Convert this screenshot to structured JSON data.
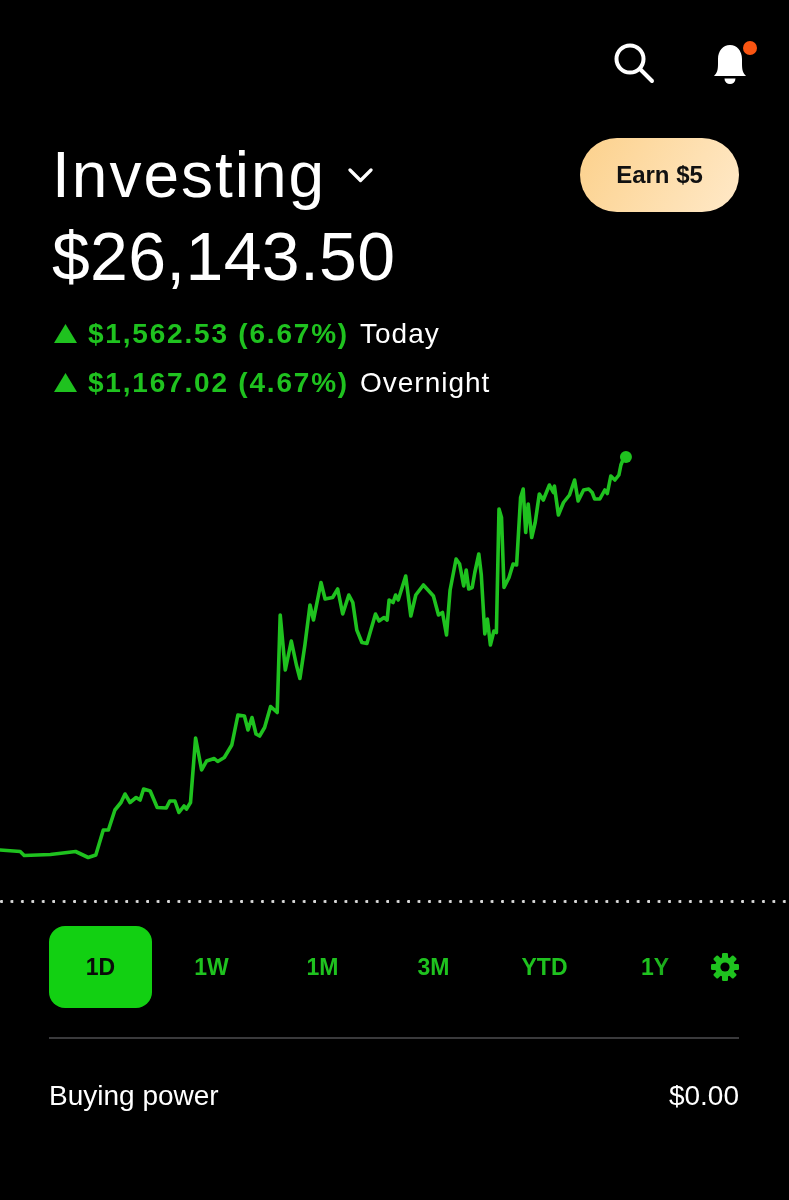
{
  "top_bar": {
    "notifications_unread": true
  },
  "header": {
    "title": "Investing",
    "button": "Earn $5"
  },
  "portfolio": {
    "value": "$26,143.50",
    "changes": [
      {
        "kind": "gain",
        "amount": "$1,562.53 (6.67%)",
        "period": "Today"
      },
      {
        "kind": "gain",
        "amount": "$1,167.02 (4.67%)",
        "period": "Overnight"
      }
    ]
  },
  "ranges": [
    {
      "label": "1D",
      "selected": true
    },
    {
      "label": "1W",
      "selected": false
    },
    {
      "label": "1M",
      "selected": false
    },
    {
      "label": "3M",
      "selected": false
    },
    {
      "label": "YTD",
      "selected": false
    },
    {
      "label": "1Y",
      "selected": false
    }
  ],
  "buying_power": {
    "label": "Buying power",
    "value": "$0.00"
  }
}
